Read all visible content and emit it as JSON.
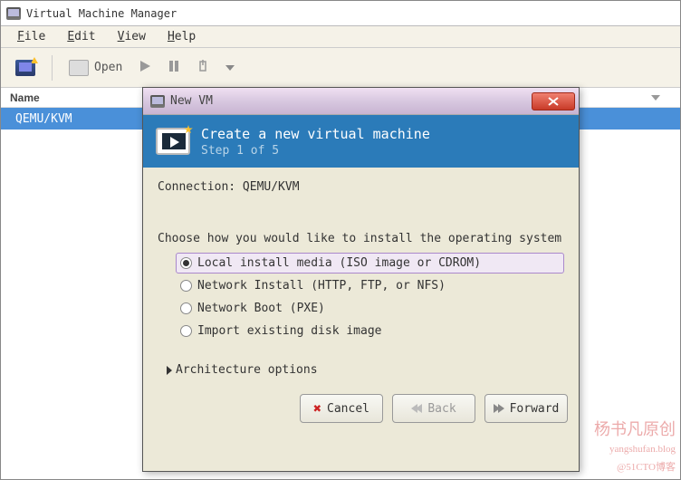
{
  "main": {
    "title": "Virtual Machine Manager",
    "menu": {
      "file": "File",
      "edit": "Edit",
      "view": "View",
      "help": "Help"
    },
    "toolbar": {
      "open": "Open"
    },
    "list": {
      "header_name": "Name",
      "row0": "QEMU/KVM"
    }
  },
  "dialog": {
    "title": "New VM",
    "heading": "Create a new virtual machine",
    "step": "Step 1 of 5",
    "connection_label": "Connection: ",
    "connection_value": "QEMU/KVM",
    "choose": "Choose how you would like to install the operating system",
    "options": {
      "local": "Local install media (ISO image or CDROM)",
      "network": "Network Install (HTTP, FTP, or NFS)",
      "netboot": "Network Boot (PXE)",
      "import": "Import existing disk image"
    },
    "arch": "Architecture options",
    "buttons": {
      "cancel": "Cancel",
      "back": "Back",
      "forward": "Forward"
    }
  },
  "watermark": {
    "line1": "杨书凡原创",
    "line2": "yangshufan.blog",
    "line3": "@51CTO博客"
  }
}
